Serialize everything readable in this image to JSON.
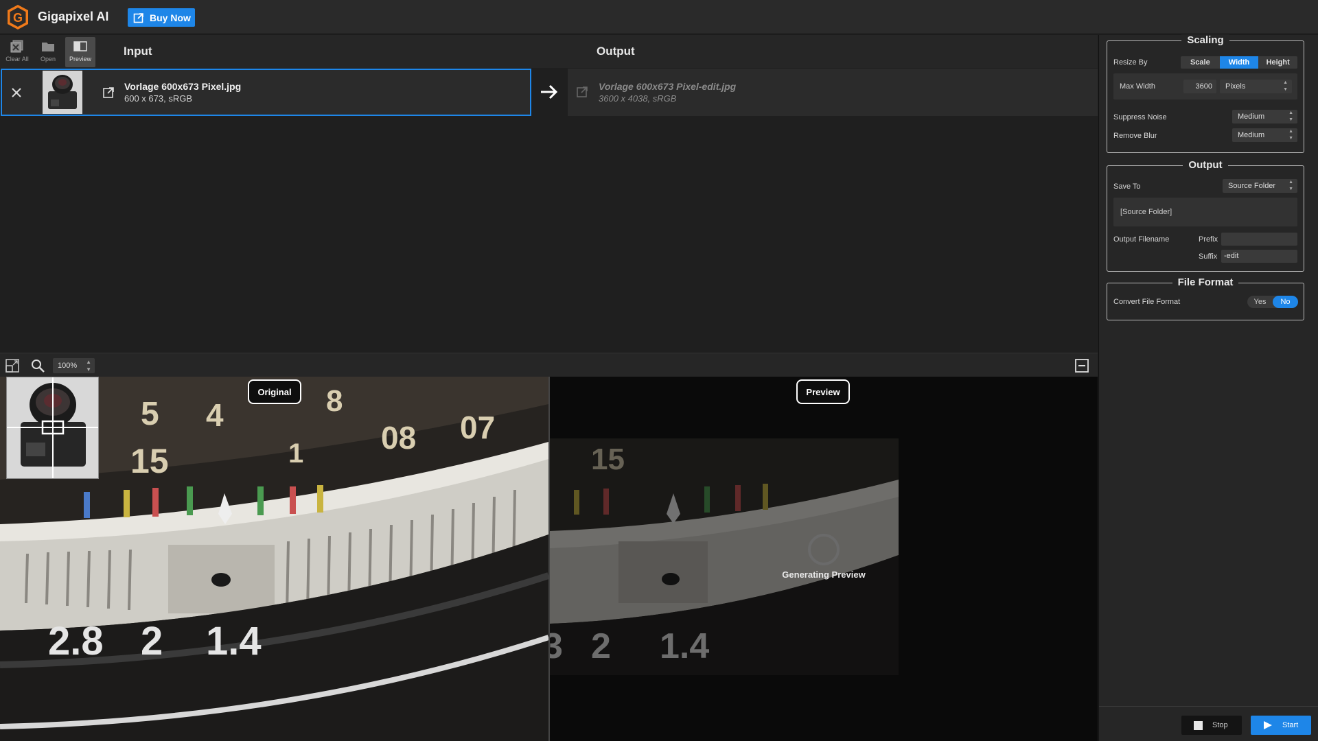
{
  "app": {
    "title": "Gigapixel AI",
    "buy_now": "Buy Now",
    "accent": "#1e86e8",
    "logo_color": "#f07a1a"
  },
  "toolbar": {
    "clear_all": "Clear All",
    "open": "Open",
    "preview": "Preview"
  },
  "headers": {
    "input": "Input",
    "output": "Output"
  },
  "input_file": {
    "name": "Vorlage 600x673 Pixel.jpg",
    "meta": "600 x 673, sRGB"
  },
  "output_file": {
    "name": "Vorlage 600x673 Pixel-edit.jpg",
    "meta": "3600 x 4038, sRGB"
  },
  "preview_bar": {
    "zoom": "100%"
  },
  "preview": {
    "original_label": "Original",
    "preview_label": "Preview",
    "generating": "Generating Preview"
  },
  "scaling": {
    "title": "Scaling",
    "resize_by_label": "Resize By",
    "resize_options": [
      "Scale",
      "Width",
      "Height"
    ],
    "resize_selected": "Width",
    "max_width_label": "Max Width",
    "max_width_value": "3600",
    "unit": "Pixels",
    "suppress_noise_label": "Suppress Noise",
    "suppress_noise_value": "Medium",
    "remove_blur_label": "Remove Blur",
    "remove_blur_value": "Medium"
  },
  "output_settings": {
    "title": "Output",
    "save_to_label": "Save To",
    "save_to_value": "Source Folder",
    "folder_path": "[Source Folder]",
    "filename_label": "Output Filename",
    "prefix_label": "Prefix",
    "prefix_value": "",
    "suffix_label": "Suffix",
    "suffix_value": "-edit"
  },
  "file_format": {
    "title": "File Format",
    "convert_label": "Convert File Format",
    "yes": "Yes",
    "no": "No",
    "selected": "No"
  },
  "actions": {
    "stop": "Stop",
    "start": "Start"
  }
}
